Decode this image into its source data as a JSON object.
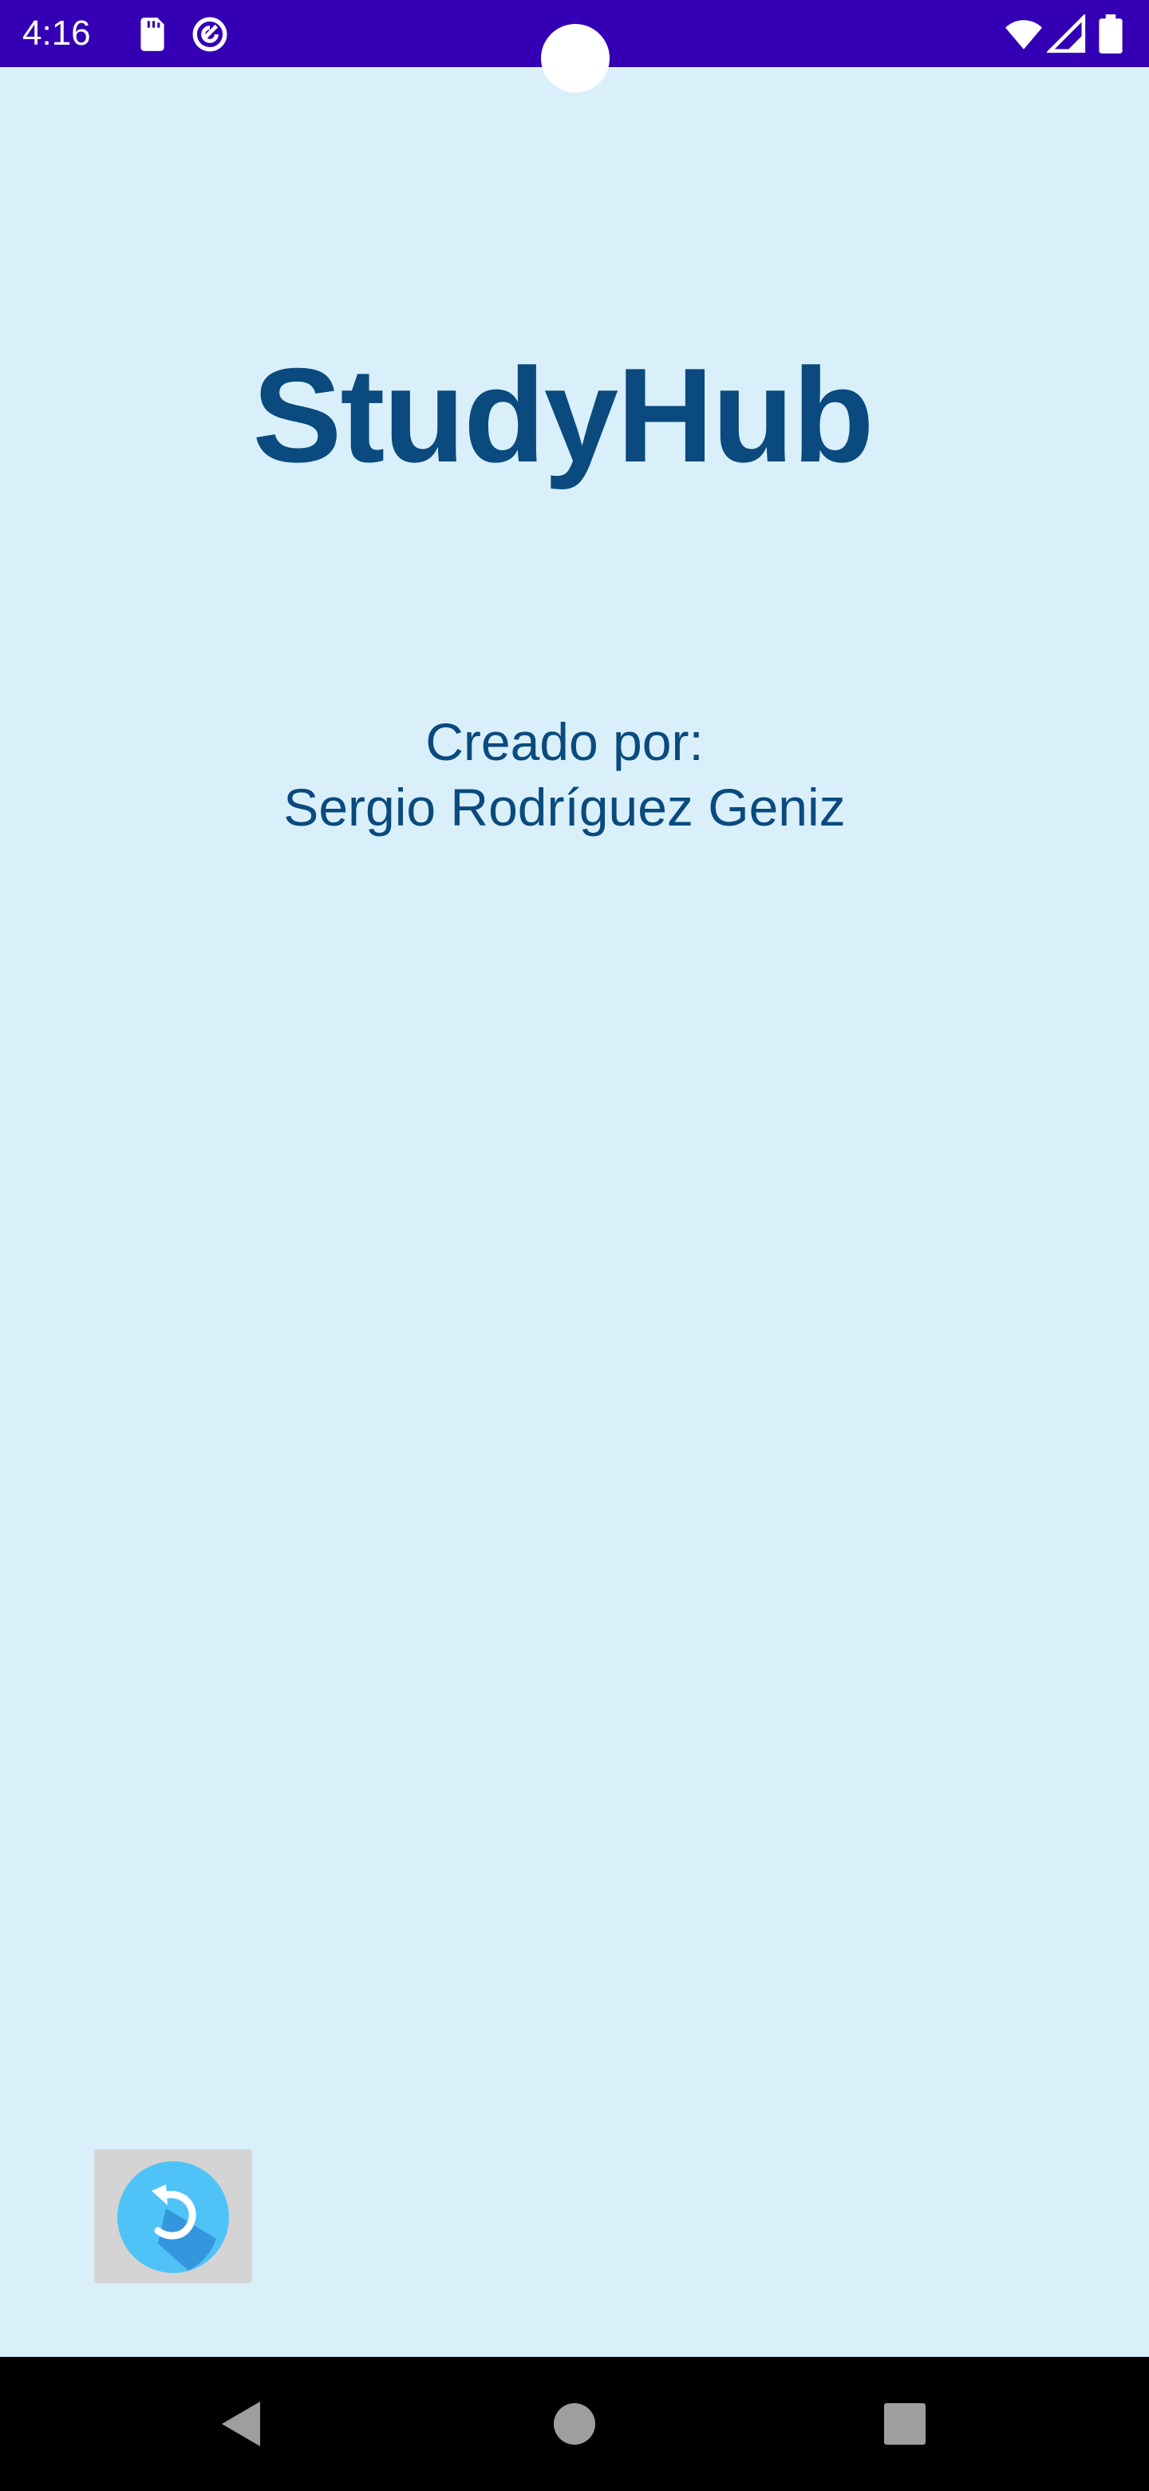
{
  "status_bar": {
    "time": "4:16",
    "background": "#3500b5",
    "icons": [
      "sd-card-icon",
      "data-saver-icon",
      "wifi-icon",
      "signal-icon",
      "battery-icon"
    ]
  },
  "app": {
    "title": "StudyHub",
    "credits_label": "Creado por:",
    "author": "Sergio Rodríguez Geniz",
    "background": "#d9f0fa",
    "text_color": "#0a4a7e"
  },
  "back_button": {
    "icon": "undo-arrow-icon",
    "color": "#4fc3f7"
  },
  "nav_bar": {
    "buttons": [
      "back-triangle-icon",
      "home-circle-icon",
      "recents-square-icon"
    ]
  }
}
